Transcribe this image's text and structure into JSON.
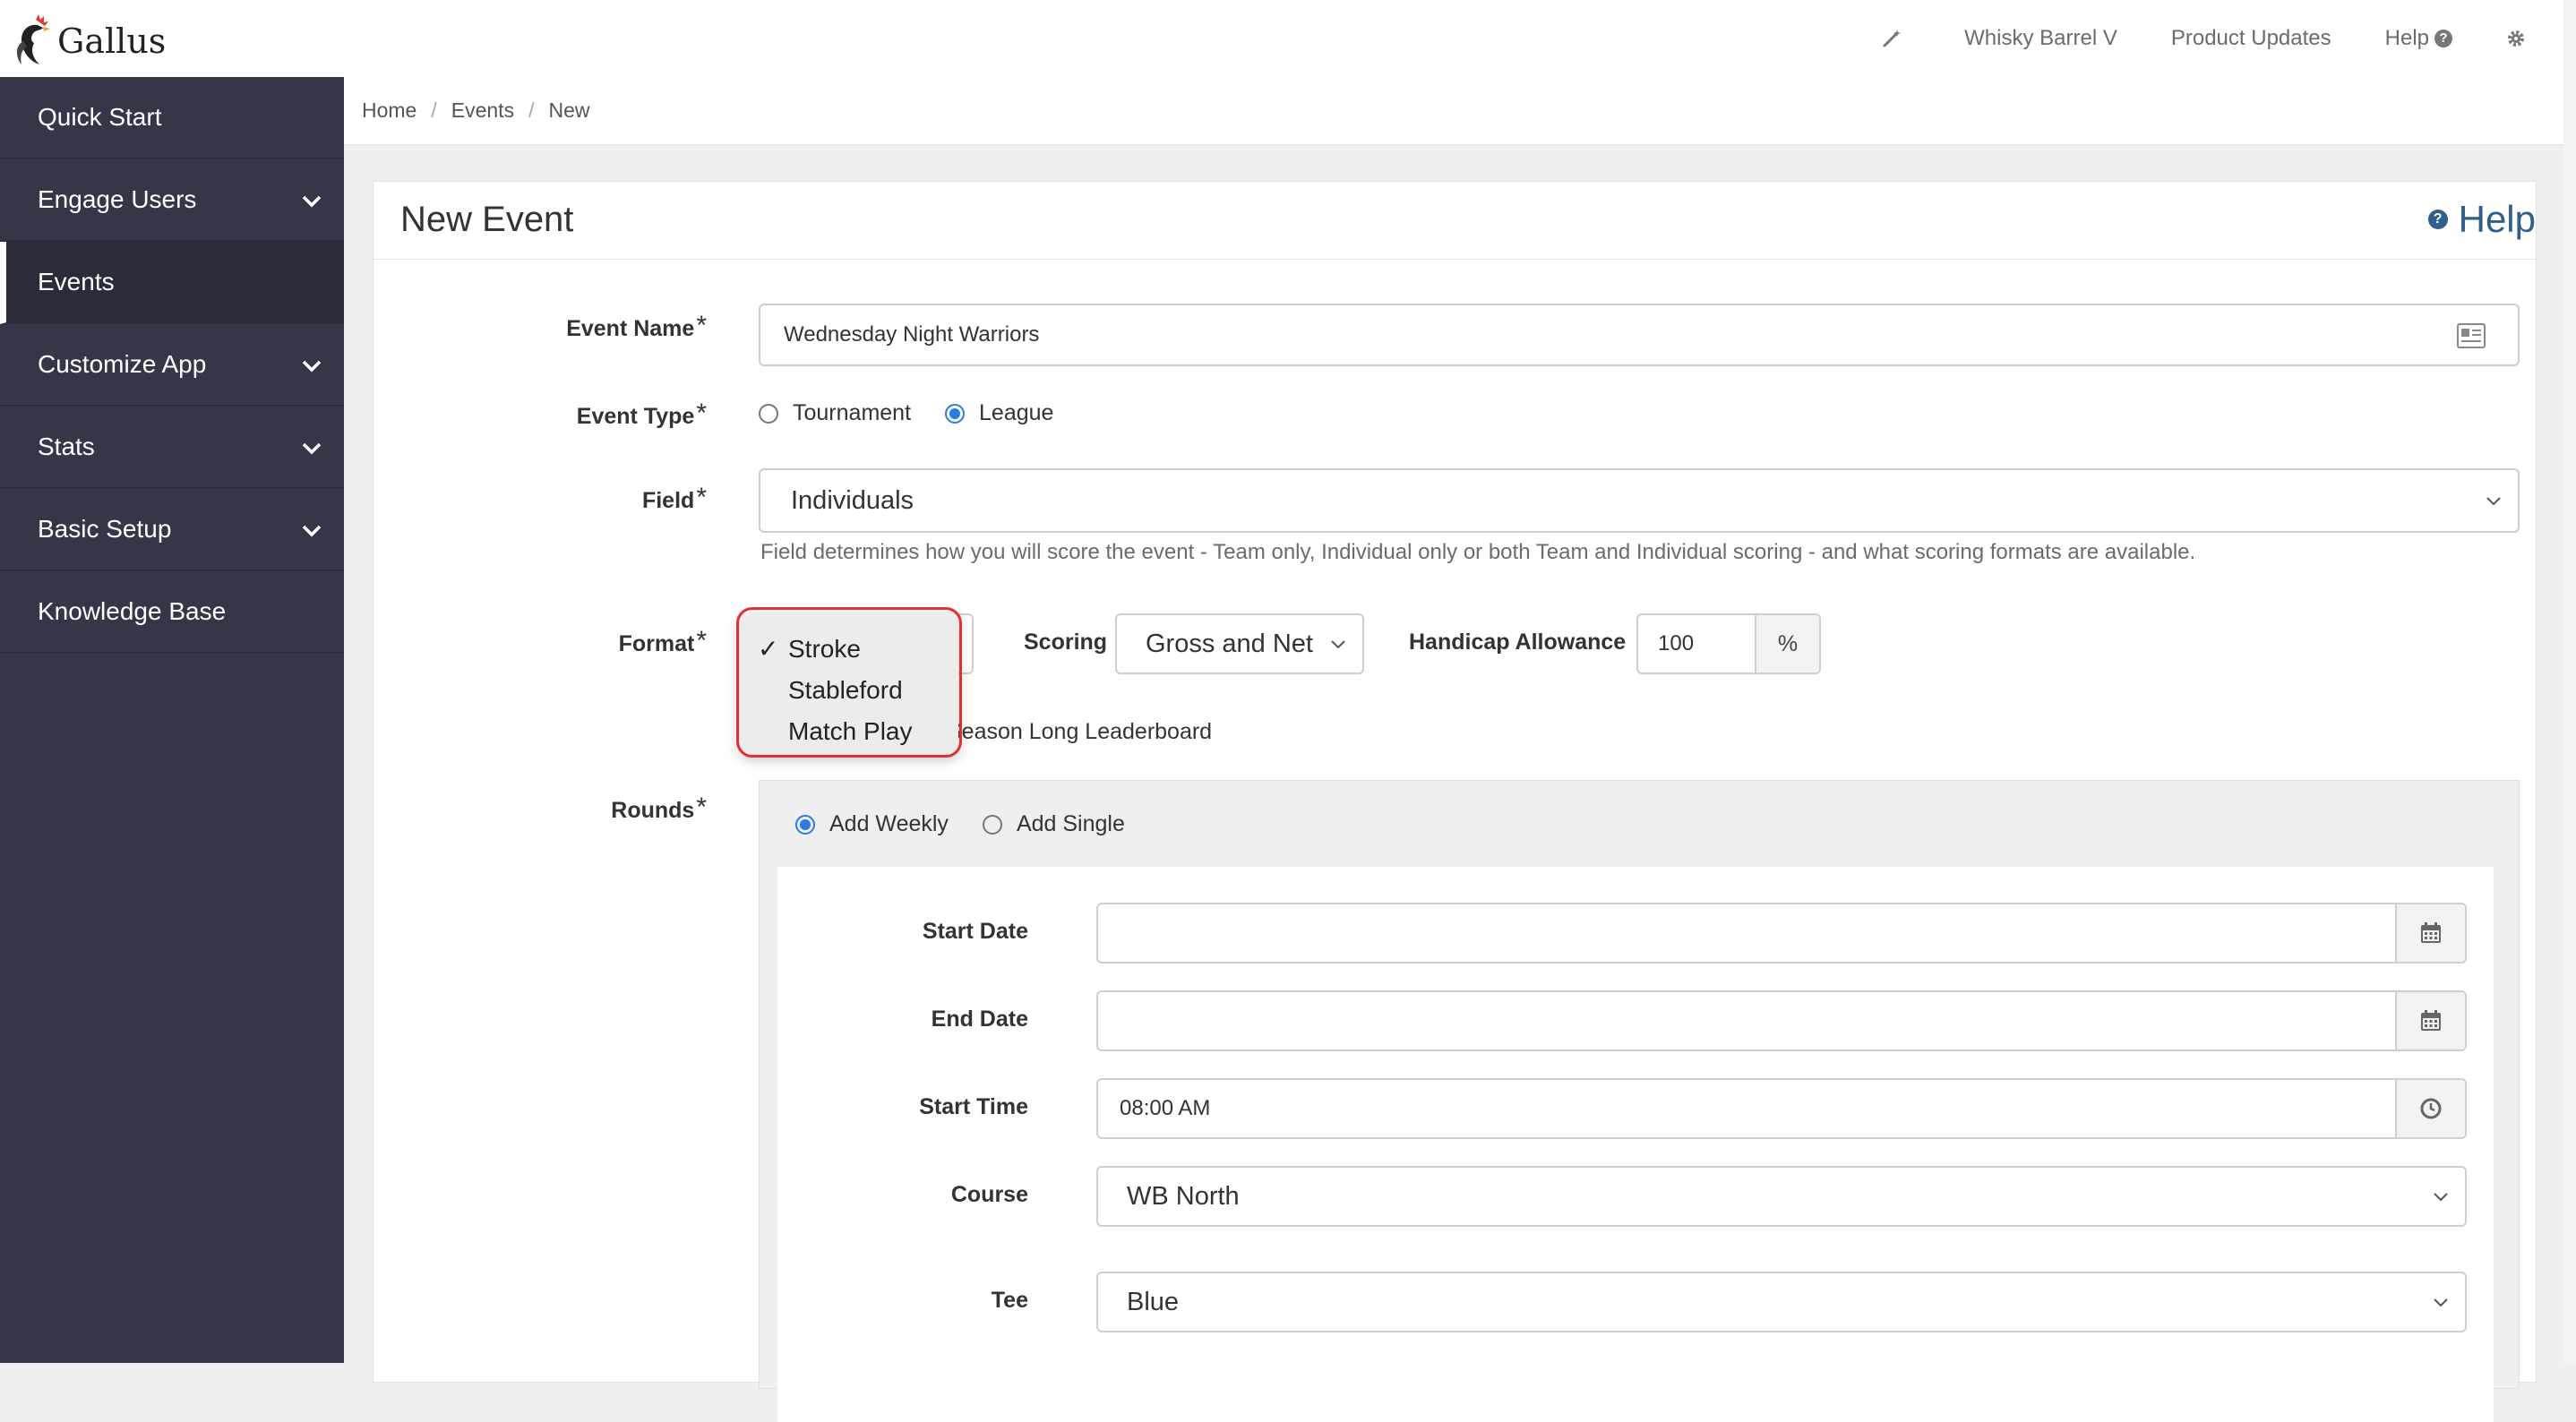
{
  "app": {
    "name": "Gallus"
  },
  "topnav": {
    "org": "Whisky Barrel V",
    "updates": "Product Updates",
    "help": "Help"
  },
  "sidebar": {
    "items": [
      {
        "label": "Quick Start",
        "expandable": false
      },
      {
        "label": "Engage Users",
        "expandable": true
      },
      {
        "label": "Events",
        "expandable": false,
        "active": true
      },
      {
        "label": "Customize App",
        "expandable": true
      },
      {
        "label": "Stats",
        "expandable": true
      },
      {
        "label": "Basic Setup",
        "expandable": true
      },
      {
        "label": "Knowledge Base",
        "expandable": false
      }
    ]
  },
  "breadcrumb": {
    "home": "Home",
    "events": "Events",
    "current": "New"
  },
  "card": {
    "title": "New Event",
    "help": "Help"
  },
  "form": {
    "event_name": {
      "label": "Event Name",
      "required": "*",
      "value": "Wednesday Night Warriors"
    },
    "event_type": {
      "label": "Event Type",
      "required": "*",
      "options": [
        "Tournament",
        "League"
      ],
      "selected": "League"
    },
    "field": {
      "label": "Field",
      "required": "*",
      "value": "Individuals",
      "hint": "Field determines how you will score the event - Team only, Individual only or both Team and Individual scoring - and what scoring formats are available."
    },
    "format": {
      "label": "Format",
      "required": "*",
      "options": [
        "Stroke",
        "Stableford",
        "Match Play"
      ],
      "selected": "Stroke",
      "check": "✓"
    },
    "scoring": {
      "label": "Scoring",
      "value": "Gross and Net"
    },
    "handicap": {
      "label": "Handicap Allowance",
      "value": "100",
      "unit": "%"
    },
    "season_long": {
      "label": "Season Long Leaderboard"
    },
    "rounds": {
      "label": "Rounds",
      "required": "*",
      "options": [
        "Add Weekly",
        "Add Single"
      ],
      "selected": "Add Weekly",
      "start_date": {
        "label": "Start Date",
        "value": ""
      },
      "end_date": {
        "label": "End Date",
        "value": ""
      },
      "start_time": {
        "label": "Start Time",
        "value": "08:00 AM"
      },
      "course": {
        "label": "Course",
        "value": "WB North"
      },
      "tee": {
        "label": "Tee",
        "value": "Blue"
      }
    }
  },
  "colors": {
    "sidebar_bg": "#353749",
    "accent": "#2c7be5",
    "help_link": "#2f5f8a",
    "highlight": "#e03030"
  }
}
